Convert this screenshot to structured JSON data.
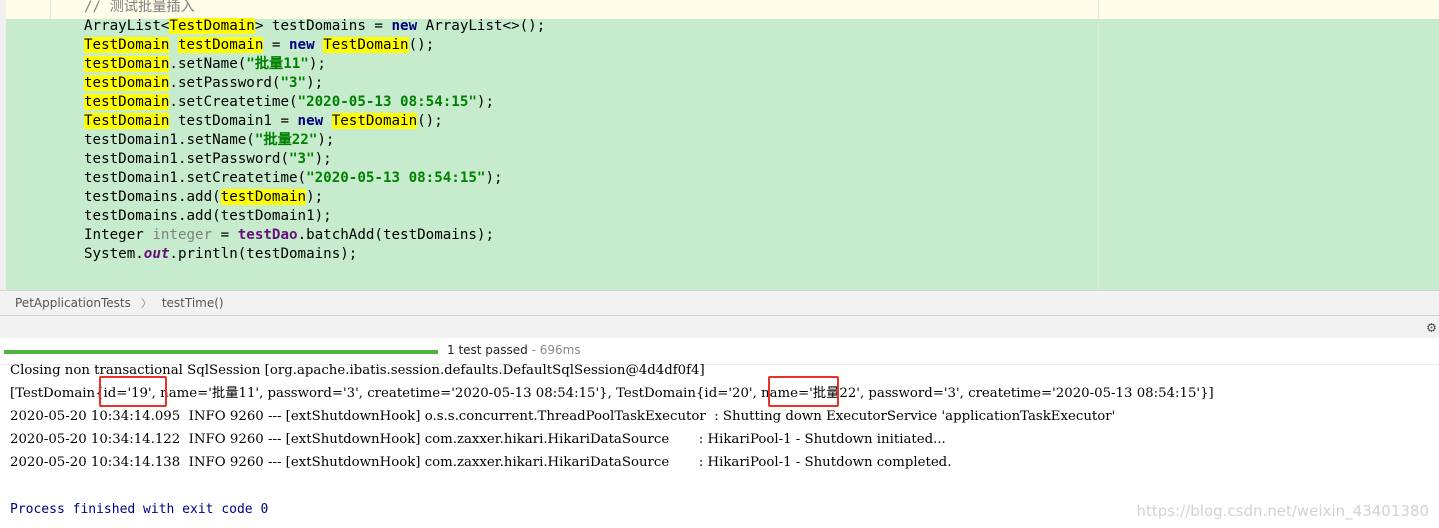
{
  "editor": {
    "lines": [
      {
        "tokens": [
          {
            "t": "// 测试批量插入",
            "c": "cmt"
          }
        ]
      },
      {
        "tokens": [
          {
            "t": "ArrayList<"
          },
          {
            "t": "TestDomain",
            "c": "mark"
          },
          {
            "t": "> testDomains = "
          },
          {
            "t": "new",
            "c": "kw"
          },
          {
            "t": " ArrayList<>();"
          }
        ]
      },
      {
        "tokens": [
          {
            "t": "TestDomain",
            "c": "mark"
          },
          {
            "t": " "
          },
          {
            "t": "testDomain",
            "c": "mark"
          },
          {
            "t": " = "
          },
          {
            "t": "new",
            "c": "kw"
          },
          {
            "t": " "
          },
          {
            "t": "TestDomain",
            "c": "mark"
          },
          {
            "t": "();"
          }
        ]
      },
      {
        "tokens": [
          {
            "t": "testDomain",
            "c": "mark"
          },
          {
            "t": ".setName("
          },
          {
            "t": "\"批量11\"",
            "c": "str"
          },
          {
            "t": ");"
          }
        ]
      },
      {
        "tokens": [
          {
            "t": "testDomain",
            "c": "mark"
          },
          {
            "t": ".setPassword("
          },
          {
            "t": "\"3\"",
            "c": "str"
          },
          {
            "t": ");"
          }
        ]
      },
      {
        "tokens": [
          {
            "t": "testDomain",
            "c": "mark"
          },
          {
            "t": ".setCreatetime("
          },
          {
            "t": "\"2020-05-13 08:54:15\"",
            "c": "str"
          },
          {
            "t": ");"
          }
        ]
      },
      {
        "tokens": [
          {
            "t": "TestDomain",
            "c": "mark"
          },
          {
            "t": " testDomain1 = "
          },
          {
            "t": "new",
            "c": "kw"
          },
          {
            "t": " "
          },
          {
            "t": "TestDomain",
            "c": "mark"
          },
          {
            "t": "();"
          }
        ]
      },
      {
        "tokens": [
          {
            "t": "testDomain1.setName("
          },
          {
            "t": "\"批量22\"",
            "c": "str"
          },
          {
            "t": ");"
          }
        ]
      },
      {
        "tokens": [
          {
            "t": "testDomain1.setPassword("
          },
          {
            "t": "\"3\"",
            "c": "str"
          },
          {
            "t": ");"
          }
        ]
      },
      {
        "tokens": [
          {
            "t": "testDomain1.setCreatetime("
          },
          {
            "t": "\"2020-05-13 08:54:15\"",
            "c": "str"
          },
          {
            "t": ");"
          }
        ]
      },
      {
        "tokens": [
          {
            "t": "testDomains.add("
          },
          {
            "t": "testDomain",
            "c": "mark"
          },
          {
            "t": ");"
          }
        ]
      },
      {
        "tokens": [
          {
            "t": "testDomains.add(testDomain1);"
          }
        ]
      },
      {
        "tokens": [
          {
            "t": "Integer "
          },
          {
            "t": "integer",
            "c": "unused"
          },
          {
            "t": " = "
          },
          {
            "t": "testDao",
            "c": "fld"
          },
          {
            "t": ".batchAdd(testDomains);"
          }
        ]
      },
      {
        "tokens": [
          {
            "t": "System."
          },
          {
            "t": "out",
            "c": "fldi"
          },
          {
            "t": ".println(testDomains);"
          }
        ]
      }
    ]
  },
  "breadcrumb": {
    "items": [
      "PetApplicationTests",
      "testTime()"
    ],
    "separator": "〉"
  },
  "run": {
    "progress_fraction": 1.0,
    "progress_color": "#4fb33f",
    "status": "1 test passed",
    "duration": " - 696ms",
    "gear_icon": "⚙"
  },
  "console": {
    "lines": [
      "Closing non transactional SqlSession [org.apache.ibatis.session.defaults.DefaultSqlSession@4d4df0f4]",
      "[TestDomain{id='19', name='批量11', password='3', createtime='2020-05-13 08:54:15'}, TestDomain{id='20', name='批量22', password='3', createtime='2020-05-13 08:54:15'}]",
      "2020-05-20 10:34:14.095  INFO 9260 --- [extShutdownHook] o.s.s.concurrent.ThreadPoolTaskExecutor  : Shutting down ExecutorService 'applicationTaskExecutor'",
      "2020-05-20 10:34:14.122  INFO 9260 --- [extShutdownHook] com.zaxxer.hikari.HikariDataSource       : HikariPool-1 - Shutdown initiated...",
      "2020-05-20 10:34:14.138  INFO 9260 --- [extShutdownHook] com.zaxxer.hikari.HikariDataSource       : HikariPool-1 - Shutdown completed.",
      "",
      "Process finished with exit code 0"
    ]
  },
  "watermark": "https://blog.csdn.net/weixin_43401380"
}
